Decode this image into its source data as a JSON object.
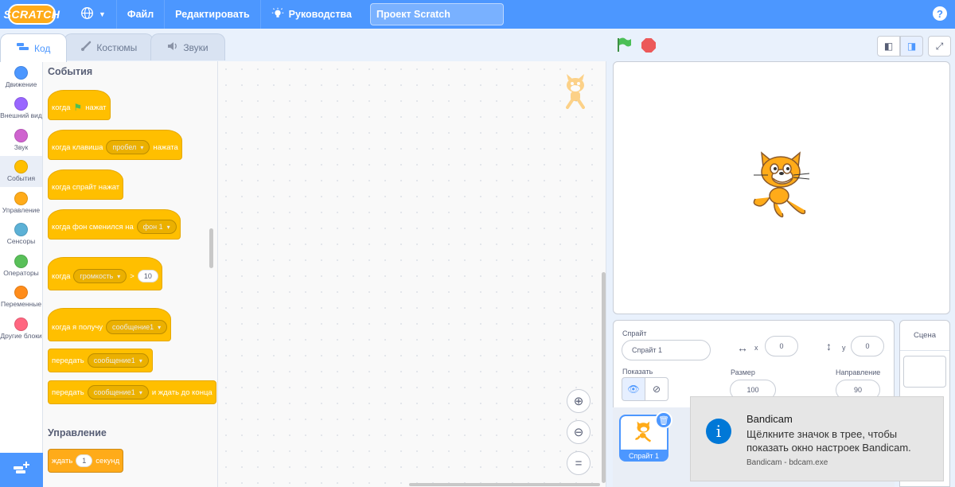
{
  "menubar": {
    "logo": "SCRATCH",
    "file": "Файл",
    "edit": "Редактировать",
    "tutorials": "Руководства",
    "project_title": "Проект Scratch",
    "help": "?"
  },
  "tabs": {
    "code": "Код",
    "costumes": "Костюмы",
    "sounds": "Звуки"
  },
  "categories": [
    {
      "label": "Движение",
      "color": "#4c97ff"
    },
    {
      "label": "Внешний вид",
      "color": "#9966ff"
    },
    {
      "label": "Звук",
      "color": "#cf63cf"
    },
    {
      "label": "События",
      "color": "#ffbf00"
    },
    {
      "label": "Управление",
      "color": "#ffab19"
    },
    {
      "label": "Сенсоры",
      "color": "#5cb1d6"
    },
    {
      "label": "Операторы",
      "color": "#59c059"
    },
    {
      "label": "Переменные",
      "color": "#ff8c1a"
    },
    {
      "label": "Другие блоки",
      "color": "#ff6680"
    }
  ],
  "palette": {
    "events_title": "События",
    "control_title": "Управление",
    "b1": {
      "a": "когда",
      "b": "нажат"
    },
    "b2": {
      "a": "когда клавиша",
      "dd": "пробел",
      "b": "нажата"
    },
    "b3": {
      "a": "когда спрайт нажат"
    },
    "b4": {
      "a": "когда фон сменился на",
      "dd": "фон 1"
    },
    "b5": {
      "a": "когда",
      "dd": "громкость",
      "op": ">",
      "num": "10"
    },
    "b6": {
      "a": "когда я получу",
      "dd": "сообщение1"
    },
    "b7": {
      "a": "передать",
      "dd": "сообщение1"
    },
    "b8": {
      "a": "передать",
      "dd": "сообщение1",
      "b": "и ждать до конца"
    },
    "b9": {
      "a": "ждать",
      "num": "1",
      "b": "секунд"
    }
  },
  "sprite_info": {
    "sprite_label": "Спрайт",
    "sprite_name": "Спрайт 1",
    "x_label": "x",
    "x_value": "0",
    "y_label": "y",
    "y_value": "0",
    "show_label": "Показать",
    "size_label": "Размер",
    "size_value": "100",
    "direction_label": "Направление",
    "direction_value": "90"
  },
  "sprite_tile": {
    "name": "Спрайт 1"
  },
  "scene": {
    "title": "Сцена"
  },
  "toast": {
    "title": "Bandicam",
    "body": "Щёлкните значок в трее, чтобы показать окно настроек Bandicam.",
    "source": "Bandicam - bdcam.exe"
  }
}
